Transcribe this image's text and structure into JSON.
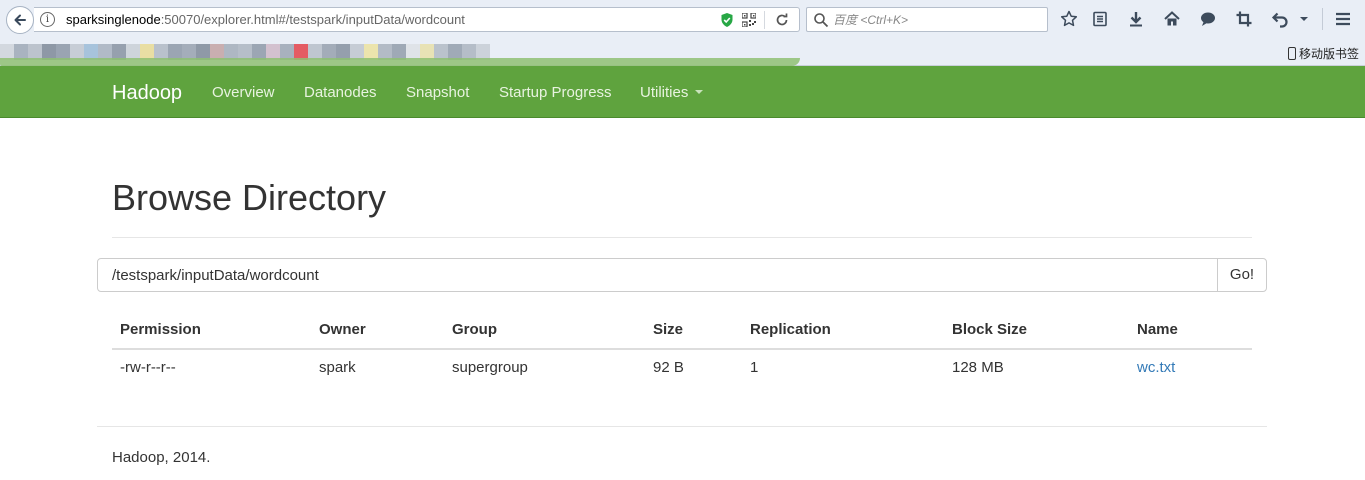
{
  "browser": {
    "url_host": "sparksinglenode",
    "url_rest": ":50070/explorer.html#/testspark/inputData/wordcount",
    "search_placeholder": "百度 <Ctrl+K>",
    "bookmark_mobile": "移动版书签"
  },
  "navbar": {
    "brand": "Hadoop",
    "items": [
      {
        "label": "Overview"
      },
      {
        "label": "Datanodes"
      },
      {
        "label": "Snapshot"
      },
      {
        "label": "Startup Progress"
      },
      {
        "label": "Utilities"
      }
    ]
  },
  "page": {
    "title": "Browse Directory",
    "path_value": "/testspark/inputData/wordcount",
    "go_label": "Go!"
  },
  "table": {
    "headers": [
      "Permission",
      "Owner",
      "Group",
      "Size",
      "Replication",
      "Block Size",
      "Name"
    ],
    "rows": [
      [
        "-rw-r--r--",
        "spark",
        "supergroup",
        "92 B",
        "1",
        "128 MB",
        "wc.txt"
      ]
    ]
  },
  "footer": {
    "text": "Hadoop, 2014."
  },
  "colors": {
    "navbar": "#5fa33e",
    "link": "#337ab7"
  }
}
